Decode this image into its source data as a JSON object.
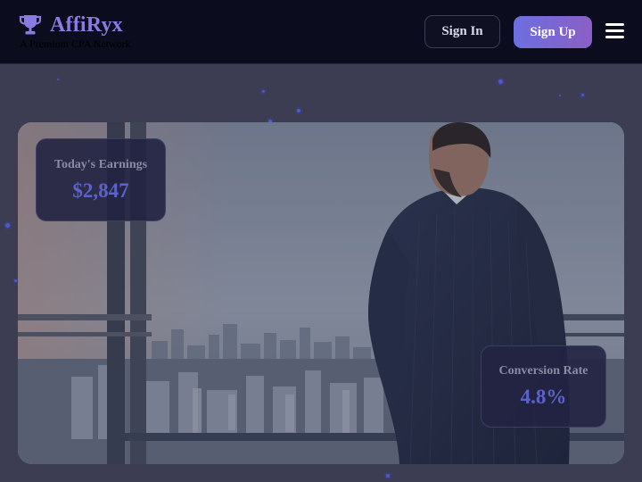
{
  "header": {
    "brand_name": "AffiRyx",
    "tagline": "A Premium CPA Network",
    "sign_in_label": "Sign In",
    "sign_up_label": "Sign Up",
    "logo_icon": "trophy-icon",
    "menu_icon": "hamburger-menu-icon"
  },
  "hero": {
    "image_description_icon": "businessman-city-view-photo",
    "stats": {
      "earnings": {
        "label": "Today's Earnings",
        "value": "$2,847"
      },
      "conversion": {
        "label": "Conversion Rate",
        "value": "4.8%"
      }
    }
  },
  "colors": {
    "header_bg": "#0b0c1d",
    "page_bg": "#3c3c52",
    "brand": "#8a7be0",
    "accent_gradient_start": "#6d6fe0",
    "accent_gradient_end": "#8a5fc4",
    "stat_value": "#5b63c9",
    "particle": "#4b58d9"
  }
}
